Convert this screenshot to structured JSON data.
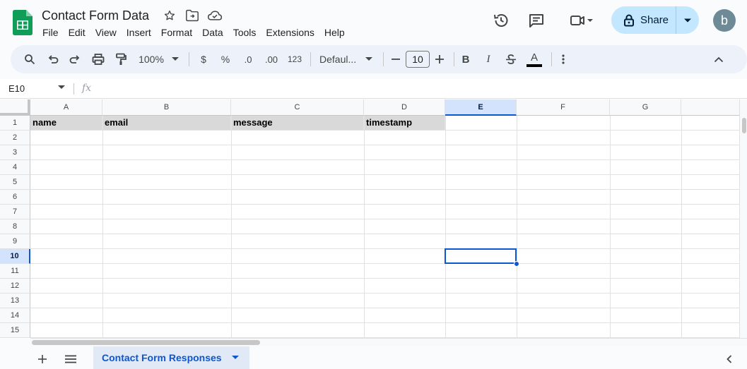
{
  "app": {
    "doc_title": "Contact Form Data",
    "brand_color": "#0f9d58",
    "accent_color": "#0b57d0"
  },
  "menu": [
    "File",
    "Edit",
    "View",
    "Insert",
    "Format",
    "Data",
    "Tools",
    "Extensions",
    "Help"
  ],
  "header_actions": {
    "share_label": "Share",
    "avatar_letter": "b"
  },
  "toolbar": {
    "zoom": "100%",
    "currency": "$",
    "percent": "%",
    "decrease_decimal": ".0",
    "increase_decimal": ".00",
    "number_format": "123",
    "font_name": "Defaul...",
    "font_size": "10",
    "bold": "B",
    "italic": "I",
    "text_color_letter": "A"
  },
  "formula_bar": {
    "cell_ref": "E10",
    "fx": "fx",
    "value": ""
  },
  "grid": {
    "columns": [
      "A",
      "B",
      "C",
      "D",
      "E",
      "F",
      "G"
    ],
    "selected_column": "E",
    "rows": [
      "1",
      "2",
      "3",
      "4",
      "5",
      "6",
      "7",
      "8",
      "9",
      "10",
      "11",
      "12",
      "13",
      "14",
      "15"
    ],
    "selected_row": "10",
    "header_row": [
      "name",
      "email",
      "message",
      "timestamp"
    ],
    "header_fill": "#d9d9d9"
  },
  "sheets": {
    "active_tab": "Contact Form Responses"
  }
}
